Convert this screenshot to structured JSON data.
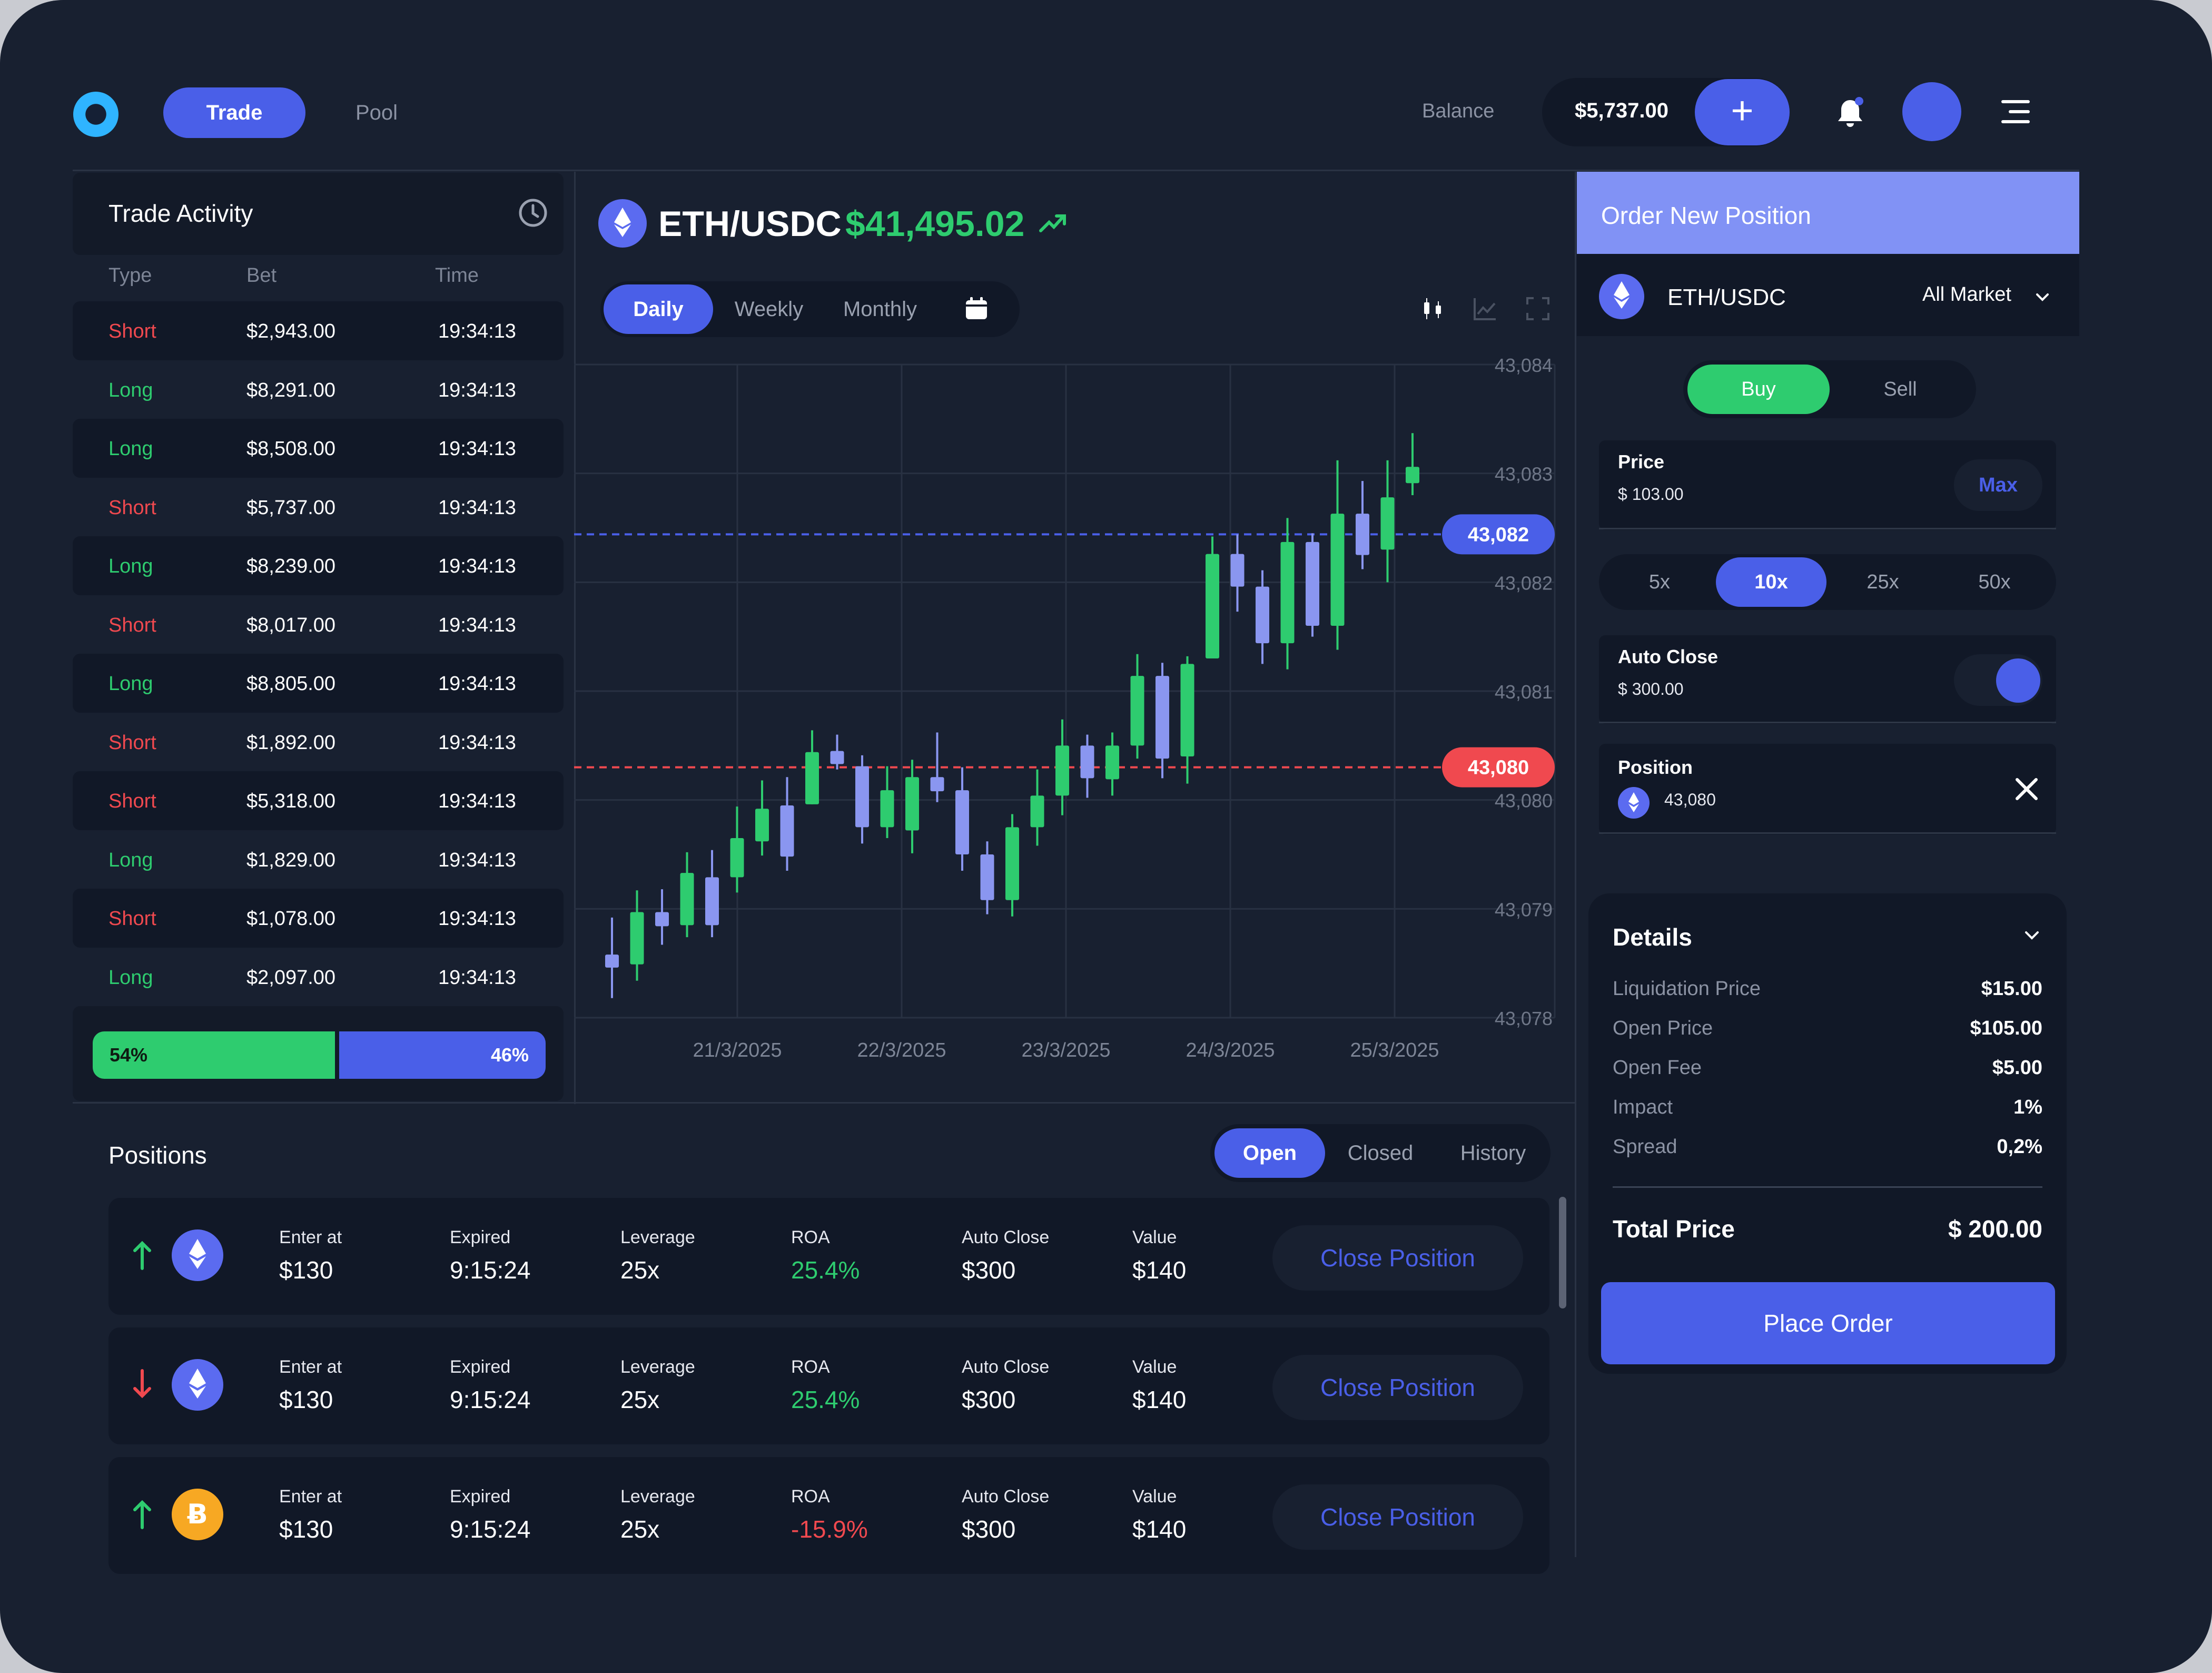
{
  "nav": {
    "trade": "Trade",
    "pool": "Pool",
    "balance_label": "Balance",
    "balance_value": "$5,737.00",
    "add": "+"
  },
  "activity": {
    "title": "Trade Activity",
    "columns": [
      "Type",
      "Bet",
      "Time"
    ],
    "rows": [
      {
        "type": "Short",
        "bet": "$2,943.00",
        "time": "19:34:13"
      },
      {
        "type": "Long",
        "bet": "$8,291.00",
        "time": "19:34:13"
      },
      {
        "type": "Long",
        "bet": "$8,508.00",
        "time": "19:34:13"
      },
      {
        "type": "Short",
        "bet": "$5,737.00",
        "time": "19:34:13"
      },
      {
        "type": "Long",
        "bet": "$8,239.00",
        "time": "19:34:13"
      },
      {
        "type": "Short",
        "bet": "$8,017.00",
        "time": "19:34:13"
      },
      {
        "type": "Long",
        "bet": "$8,805.00",
        "time": "19:34:13"
      },
      {
        "type": "Short",
        "bet": "$1,892.00",
        "time": "19:34:13"
      },
      {
        "type": "Short",
        "bet": "$5,318.00",
        "time": "19:34:13"
      },
      {
        "type": "Long",
        "bet": "$1,829.00",
        "time": "19:34:13"
      },
      {
        "type": "Short",
        "bet": "$1,078.00",
        "time": "19:34:13"
      },
      {
        "type": "Long",
        "bet": "$2,097.00",
        "time": "19:34:13"
      }
    ],
    "long_pct": "54%",
    "short_pct": "46%",
    "long_fraction": 0.54
  },
  "chart_header": {
    "pair": "ETH/USDC",
    "price": "$41,495.02",
    "tabs": [
      "Daily",
      "Weekly",
      "Monthly"
    ],
    "active_tab": "Daily"
  },
  "chart_data": {
    "type": "candlestick",
    "ylim": [
      43078,
      43084
    ],
    "y_ticks": [
      "43,084",
      "43,083",
      "43,082",
      "43,081",
      "43,080",
      "43,079",
      "43,078"
    ],
    "x_ticks": [
      "21/3/2025",
      "22/3/2025",
      "23/3/2025",
      "24/3/2025",
      "25/3/2025"
    ],
    "markers": [
      {
        "label": "43,082",
        "value": 43082.44,
        "color": "#4a5fe8"
      },
      {
        "label": "43,080",
        "value": 43080.3,
        "color": "#f0494f"
      }
    ],
    "candles": [
      {
        "o": 43078.58,
        "c": 43078.46,
        "h": 43078.92,
        "l": 43078.18,
        "up": false
      },
      {
        "o": 43078.49,
        "c": 43078.97,
        "h": 43079.17,
        "l": 43078.34,
        "up": true
      },
      {
        "o": 43078.97,
        "c": 43078.84,
        "h": 43079.18,
        "l": 43078.67,
        "up": false
      },
      {
        "o": 43078.85,
        "c": 43079.33,
        "h": 43079.52,
        "l": 43078.74,
        "up": true
      },
      {
        "o": 43079.29,
        "c": 43078.85,
        "h": 43079.54,
        "l": 43078.74,
        "up": false
      },
      {
        "o": 43079.29,
        "c": 43079.65,
        "h": 43079.94,
        "l": 43079.15,
        "up": true
      },
      {
        "o": 43079.62,
        "c": 43079.92,
        "h": 43080.18,
        "l": 43079.49,
        "up": true
      },
      {
        "o": 43079.95,
        "c": 43079.48,
        "h": 43080.21,
        "l": 43079.35,
        "up": false
      },
      {
        "o": 43079.96,
        "c": 43080.44,
        "h": 43080.64,
        "l": 43079.96,
        "up": true
      },
      {
        "o": 43080.45,
        "c": 43080.33,
        "h": 43080.6,
        "l": 43080.28,
        "up": false
      },
      {
        "o": 43080.31,
        "c": 43079.75,
        "h": 43080.41,
        "l": 43079.6,
        "up": false
      },
      {
        "o": 43079.75,
        "c": 43080.09,
        "h": 43080.31,
        "l": 43079.65,
        "up": true
      },
      {
        "o": 43079.72,
        "c": 43080.21,
        "h": 43080.37,
        "l": 43079.51,
        "up": true
      },
      {
        "o": 43080.21,
        "c": 43080.08,
        "h": 43080.62,
        "l": 43079.98,
        "up": false
      },
      {
        "o": 43080.09,
        "c": 43079.5,
        "h": 43080.3,
        "l": 43079.35,
        "up": false
      },
      {
        "o": 43079.5,
        "c": 43079.08,
        "h": 43079.62,
        "l": 43078.95,
        "up": false
      },
      {
        "o": 43079.08,
        "c": 43079.75,
        "h": 43079.87,
        "l": 43078.93,
        "up": true
      },
      {
        "o": 43079.75,
        "c": 43080.04,
        "h": 43080.28,
        "l": 43079.58,
        "up": true
      },
      {
        "o": 43080.04,
        "c": 43080.5,
        "h": 43080.74,
        "l": 43079.86,
        "up": true
      },
      {
        "o": 43080.5,
        "c": 43080.2,
        "h": 43080.6,
        "l": 43080.02,
        "up": false
      },
      {
        "o": 43080.19,
        "c": 43080.5,
        "h": 43080.62,
        "l": 43080.04,
        "up": true
      },
      {
        "o": 43080.5,
        "c": 43081.14,
        "h": 43081.34,
        "l": 43080.38,
        "up": true
      },
      {
        "o": 43081.14,
        "c": 43080.38,
        "h": 43081.26,
        "l": 43080.2,
        "up": false
      },
      {
        "o": 43080.4,
        "c": 43081.25,
        "h": 43081.32,
        "l": 43080.15,
        "up": true
      },
      {
        "o": 43081.3,
        "c": 43082.26,
        "h": 43082.42,
        "l": 43081.3,
        "up": true
      },
      {
        "o": 43082.26,
        "c": 43081.96,
        "h": 43082.44,
        "l": 43081.73,
        "up": false
      },
      {
        "o": 43081.96,
        "c": 43081.44,
        "h": 43082.11,
        "l": 43081.25,
        "up": false
      },
      {
        "o": 43081.44,
        "c": 43082.37,
        "h": 43082.59,
        "l": 43081.2,
        "up": true
      },
      {
        "o": 43082.37,
        "c": 43081.6,
        "h": 43082.45,
        "l": 43081.5,
        "up": false
      },
      {
        "o": 43081.6,
        "c": 43082.63,
        "h": 43083.12,
        "l": 43081.38,
        "up": true
      },
      {
        "o": 43082.63,
        "c": 43082.25,
        "h": 43082.93,
        "l": 43082.12,
        "up": false
      },
      {
        "o": 43082.3,
        "c": 43082.78,
        "h": 43083.12,
        "l": 43082.0,
        "up": true
      },
      {
        "o": 43082.91,
        "c": 43083.06,
        "h": 43083.37,
        "l": 43082.8,
        "up": true
      }
    ]
  },
  "order": {
    "title": "Order New Position",
    "pair": "ETH/USDC",
    "market": "All Market",
    "buy": "Buy",
    "sell": "Sell",
    "price_label": "Price",
    "price_value": "$ 103.00",
    "max": "Max",
    "leverage_options": [
      "5x",
      "10x",
      "25x",
      "50x"
    ],
    "leverage_active": "10x",
    "auto_close_label": "Auto Close",
    "auto_close_value": "$ 300.00",
    "position_label": "Position",
    "position_value": "43,080"
  },
  "details": {
    "title": "Details",
    "rows": [
      {
        "label": "Liquidation Price",
        "value": "$15.00"
      },
      {
        "label": "Open Price",
        "value": "$105.00"
      },
      {
        "label": "Open Fee",
        "value": "$5.00"
      },
      {
        "label": "Impact",
        "value": "1%"
      },
      {
        "label": "Spread",
        "value": "0,2%"
      }
    ],
    "total_label": "Total Price",
    "total_value": "$ 200.00",
    "place_order": "Place Order"
  },
  "positions": {
    "title": "Positions",
    "tabs": [
      "Open",
      "Closed",
      "History"
    ],
    "active_tab": "Open",
    "labels": [
      "Enter at",
      "Expired",
      "Leverage",
      "ROA",
      "Auto Close",
      "Value"
    ],
    "close_label": "Close Position",
    "rows": [
      {
        "direction": "up",
        "coin": "eth",
        "enter": "$130",
        "expired": "9:15:24",
        "leverage": "25x",
        "roa": "25.4%",
        "roa_positive": true,
        "auto_close": "$300",
        "value": "$140"
      },
      {
        "direction": "down",
        "coin": "eth",
        "enter": "$130",
        "expired": "9:15:24",
        "leverage": "25x",
        "roa": "25.4%",
        "roa_positive": true,
        "auto_close": "$300",
        "value": "$140"
      },
      {
        "direction": "up",
        "coin": "btc",
        "enter": "$130",
        "expired": "9:15:24",
        "leverage": "25x",
        "roa": "-15.9%",
        "roa_positive": false,
        "auto_close": "$300",
        "value": "$140"
      }
    ]
  },
  "colors": {
    "accent": "#4a5fe8",
    "up": "#2ecc6f",
    "down": "#8a96f0",
    "negative": "#f0494f",
    "btc": "#f7a823"
  }
}
